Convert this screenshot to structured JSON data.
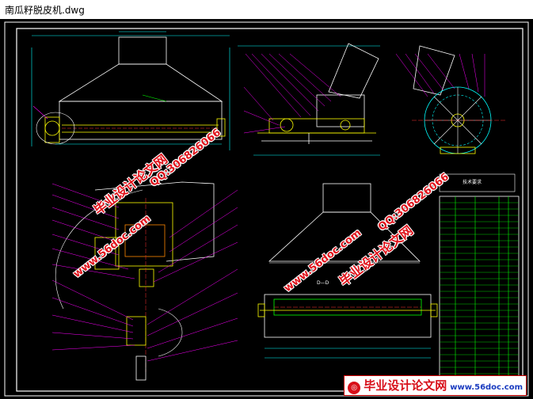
{
  "window": {
    "title": "南瓜籽脱皮机.dwg"
  },
  "drawing": {
    "section_label": "D—D",
    "table_heading": "技术要求",
    "colors": {
      "background": "#000000",
      "frame": "#ffffff",
      "part": "#ffff00",
      "leader": "#ff00ff",
      "dimension": "#00ffff",
      "table": "#00ff00",
      "center": "#ff3030"
    }
  },
  "watermarks": {
    "site_cn": "毕业设计论文网",
    "qq": "QQ:306826066",
    "url": "www.56doc.com",
    "color": "#e0141c"
  },
  "logo": {
    "cn": "毕业设计论文网",
    "url": "www.56doc.com"
  }
}
